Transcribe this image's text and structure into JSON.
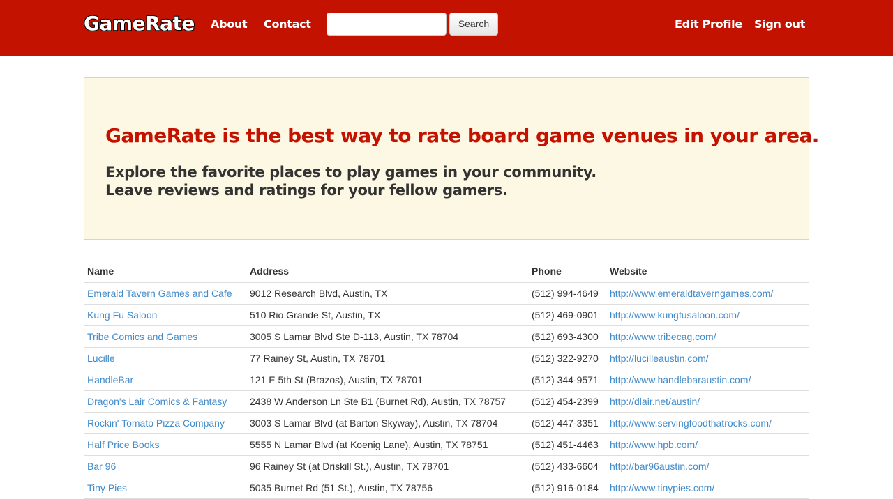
{
  "navbar": {
    "brand": "GameRate",
    "links": {
      "about": "About",
      "contact": "Contact",
      "edit_profile": "Edit Profile",
      "sign_out": "Sign out"
    },
    "search": {
      "value": "",
      "placeholder": "",
      "button_label": "Search"
    },
    "background_color": "#c41200"
  },
  "jumbotron": {
    "headline": "GameRate is the best way to rate board game venues in your area.",
    "lead_line1": "Explore the favorite places to play games in your community.",
    "lead_line2": "Leave reviews and ratings for your fellow gamers.",
    "background_color": "#fcf8e3",
    "headline_color": "#c41200"
  },
  "table": {
    "headers": [
      "Name",
      "Address",
      "Phone",
      "Website"
    ],
    "rows": [
      {
        "name": "Emerald Tavern Games and Cafe",
        "address": "9012 Research Blvd, Austin, TX",
        "phone": "(512) 994-4649",
        "website": "http://www.emeraldtaverngames.com/"
      },
      {
        "name": "Kung Fu Saloon",
        "address": "510 Rio Grande St, Austin, TX",
        "phone": "(512) 469-0901",
        "website": "http://www.kungfusaloon.com/"
      },
      {
        "name": "Tribe Comics and Games",
        "address": "3005 S Lamar Blvd Ste D-113, Austin, TX 78704",
        "phone": "(512) 693-4300",
        "website": "http://www.tribecag.com/"
      },
      {
        "name": "Lucille",
        "address": "77 Rainey St, Austin, TX 78701",
        "phone": "(512) 322-9270",
        "website": "http://lucilleaustin.com/"
      },
      {
        "name": "HandleBar",
        "address": "121 E 5th St (Brazos), Austin, TX 78701",
        "phone": "(512) 344-9571",
        "website": "http://www.handlebaraustin.com/"
      },
      {
        "name": "Dragon's Lair Comics & Fantasy",
        "address": "2438 W Anderson Ln Ste B1 (Burnet Rd), Austin, TX 78757",
        "phone": "(512) 454-2399",
        "website": "http://dlair.net/austin/"
      },
      {
        "name": "Rockin' Tomato Pizza Company",
        "address": "3003 S Lamar Blvd (at Barton Skyway), Austin, TX 78704",
        "phone": "(512) 447-3351",
        "website": "http://www.servingfoodthatrocks.com/"
      },
      {
        "name": "Half Price Books",
        "address": "5555 N Lamar Blvd (at Koenig Lane), Austin, TX 78751",
        "phone": "(512) 451-4463",
        "website": "http://www.hpb.com/"
      },
      {
        "name": "Bar 96",
        "address": "96 Rainey St (at Driskill St.), Austin, TX 78701",
        "phone": "(512) 433-6604",
        "website": "http://bar96austin.com/"
      },
      {
        "name": "Tiny Pies",
        "address": "5035 Burnet Rd (51 St.), Austin, TX 78756",
        "phone": "(512) 916-0184",
        "website": "http://www.tinypies.com/"
      }
    ],
    "link_color": "#428bca"
  }
}
